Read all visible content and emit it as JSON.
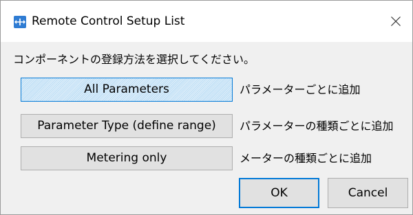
{
  "window": {
    "title": "Remote Control Setup List",
    "app_icon": "app-logo-icon",
    "close_icon": "close-icon"
  },
  "prompt": "コンポーネントの登録方法を選択してください。",
  "options": [
    {
      "label": "All Parameters",
      "description": "パラメーターごとに追加",
      "selected": true
    },
    {
      "label": "Parameter Type (define range)",
      "description": "パラメーターの種類ごとに追加",
      "selected": false
    },
    {
      "label": "Metering only",
      "description": "メーターの種類ごとに追加",
      "selected": false
    }
  ],
  "buttons": {
    "ok_label": "OK",
    "cancel_label": "Cancel"
  },
  "colors": {
    "accent": "#0078d7",
    "app_icon_bg": "#2f7cd3",
    "dialog_bg": "#f0f0f0",
    "button_bg": "#e1e1e1"
  }
}
